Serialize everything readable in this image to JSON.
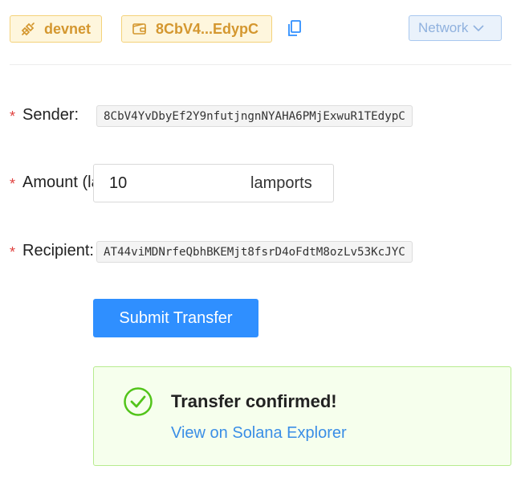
{
  "toolbar": {
    "network_label": "devnet",
    "address_short": "8CbV4...EdypC",
    "network_select_label": "Network"
  },
  "form": {
    "sender_label": "Sender:",
    "sender_value": "8CbV4YvDbyEf2Y9nfutjngnNYAHA6PMjExwuR1TEdypC",
    "amount_label": "Amount (lamports):",
    "amount_value": "10",
    "amount_unit": "lamports",
    "recipient_label": "Recipient:",
    "recipient_value": "AT44viMDNrfeQbhBKEMjt8fsrD4oFdtM8ozLv53KcJYC",
    "required_mark": "*"
  },
  "submit": {
    "label": "Submit Transfer"
  },
  "result": {
    "title": "Transfer confirmed!",
    "link_text": "View on Solana Explorer"
  },
  "colors": {
    "accent": "#2f8fff",
    "warning_bg": "#fef6dd",
    "warning_text": "#d4972f",
    "success_bg": "#f6ffed",
    "success_border": "#b7eb8f",
    "success_icon": "#52c41a",
    "required": "#e0413f"
  },
  "icons": {
    "network": "plug-icon",
    "wallet": "wallet-icon",
    "copy": "copy-icon",
    "select": "chevron-down-icon",
    "success": "check-circle-icon"
  }
}
